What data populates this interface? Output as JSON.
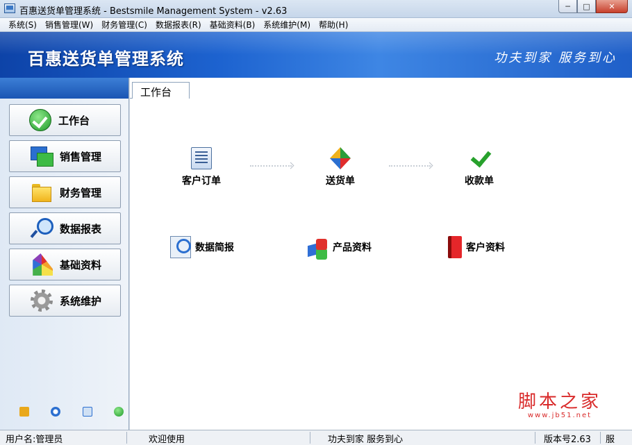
{
  "window": {
    "title": "百惠送货单管理系统 - Bestsmile Management System - v2.63",
    "minimize_glyph": "─",
    "maximize_glyph": "□",
    "close_glyph": "✕"
  },
  "menu": [
    "系统(S)",
    "销售管理(W)",
    "财务管理(C)",
    "数据报表(R)",
    "基础资料(B)",
    "系统维护(M)",
    "帮助(H)"
  ],
  "banner": {
    "app_title": "百惠送货单管理系统",
    "slogan": "功夫到家 服务到心"
  },
  "sidebar": {
    "items": [
      {
        "label": "工作台",
        "icon": "check-icon"
      },
      {
        "label": "销售管理",
        "icon": "windows-icon"
      },
      {
        "label": "财务管理",
        "icon": "folder-icon"
      },
      {
        "label": "数据报表",
        "icon": "magnifier-icon"
      },
      {
        "label": "基础资料",
        "icon": "palette-icon"
      },
      {
        "label": "系统维护",
        "icon": "gear-icon"
      }
    ],
    "tools": [
      "key-icon",
      "clock-icon",
      "search-icon",
      "back-icon"
    ]
  },
  "tab": {
    "label": "工作台"
  },
  "workflow": [
    {
      "label": "客户订单",
      "icon": "order-document-icon"
    },
    {
      "label": "送货单",
      "icon": "recycle-arrows-icon"
    },
    {
      "label": "收款单",
      "icon": "checkmark-icon"
    }
  ],
  "quick_links": [
    {
      "label": "数据简报",
      "icon": "report-magnifier-icon"
    },
    {
      "label": "产品资料",
      "icon": "cubes-icon"
    },
    {
      "label": "客户资料",
      "icon": "red-book-icon"
    }
  ],
  "watermark": {
    "main": "脚本之家",
    "url": "www.jb51.net"
  },
  "status": {
    "user": "用户名:管理员",
    "welcome": "欢迎使用",
    "slogan": "功夫到家 服务到心",
    "version": "版本号2.63",
    "extra": "服"
  },
  "colors": {
    "banner": "#1d63d0",
    "sidebar_header": "#1a55b3",
    "accent_green": "#27a12c",
    "watermark": "#d92a2a"
  }
}
